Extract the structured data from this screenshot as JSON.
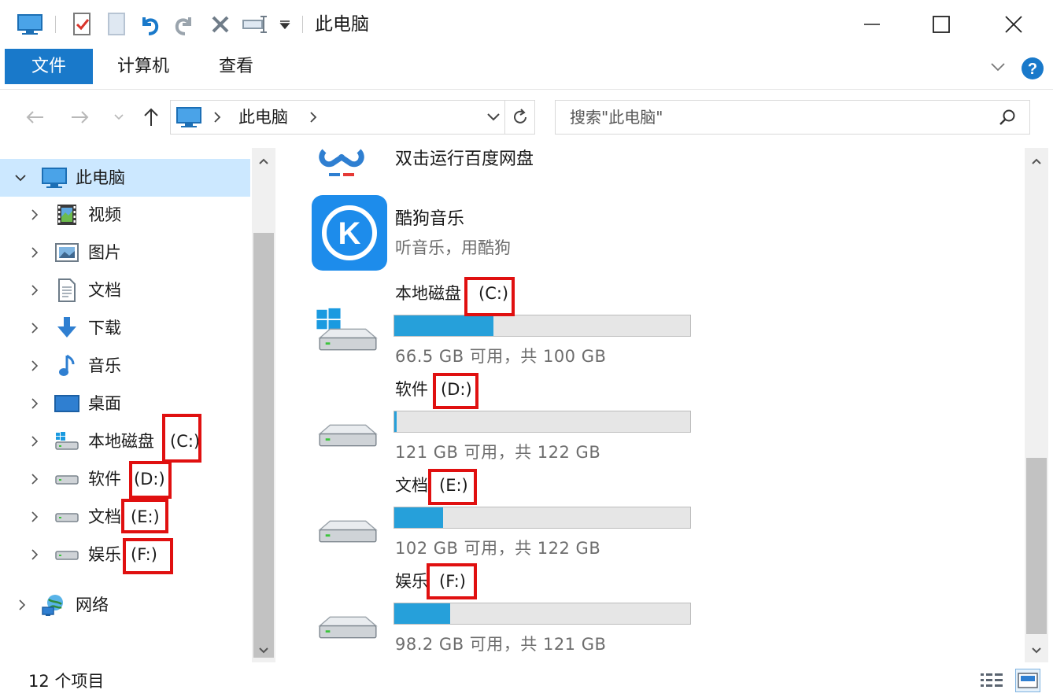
{
  "window": {
    "title": "此电脑"
  },
  "ribbon": {
    "tabs": [
      "文件",
      "计算机",
      "查看"
    ]
  },
  "address": {
    "path": "此电脑"
  },
  "search": {
    "placeholder": "搜索\"此电脑\""
  },
  "nav": {
    "root": "此电脑",
    "items": [
      "视频",
      "图片",
      "文档",
      "下载",
      "音乐",
      "桌面",
      "本地磁盘",
      "软件",
      "文档",
      "娱乐"
    ],
    "drive_letters": [
      "(C:)",
      "(D:)",
      "(E:)",
      "(F:)"
    ],
    "network": "网络"
  },
  "apps": [
    {
      "name": "双击运行百度网盘",
      "subtitle": ""
    },
    {
      "name": "酷狗音乐",
      "subtitle": "听音乐，用酷狗",
      "icon_letter": "K"
    }
  ],
  "drives": [
    {
      "label": "本地磁盘",
      "letter": "(C:)",
      "info": "66.5 GB 可用，共 100 GB",
      "used_fraction": 0.335
    },
    {
      "label": "软件",
      "letter": "(D:)",
      "info": "121 GB 可用，共 122 GB",
      "used_fraction": 0.008
    },
    {
      "label": "文档",
      "letter": "(E:)",
      "info": "102 GB 可用，共 122 GB",
      "used_fraction": 0.164
    },
    {
      "label": "娱乐",
      "letter": "(F:)",
      "info": "98.2 GB 可用，共 121 GB",
      "used_fraction": 0.188
    }
  ],
  "status": {
    "count": "12 个项目"
  },
  "colors": {
    "accent": "#1979ca",
    "selection": "#cce8ff",
    "bar_fill": "#26a0da",
    "highlight": "#e01010"
  }
}
